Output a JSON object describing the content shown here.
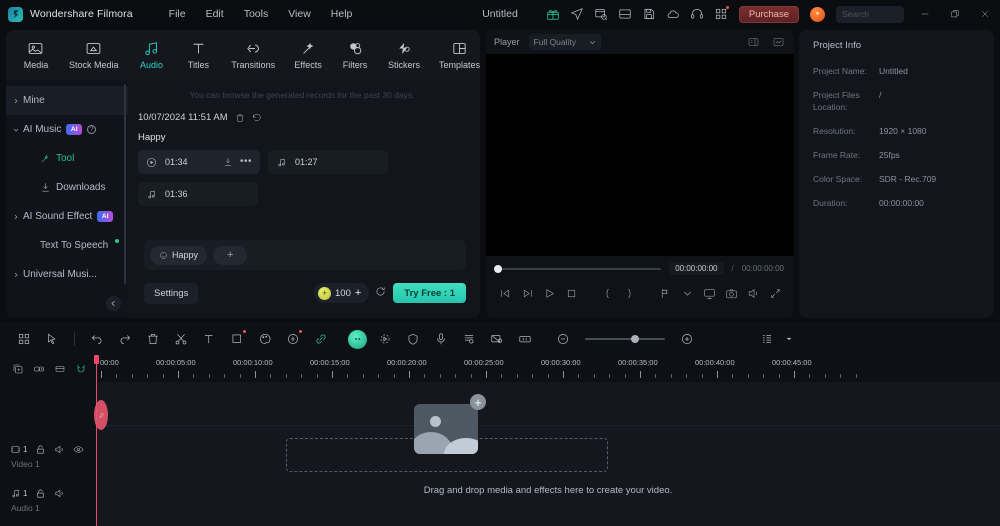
{
  "titlebar": {
    "brand": "Wondershare Filmora",
    "menus": [
      "File",
      "Edit",
      "Tools",
      "View",
      "Help"
    ],
    "document_title": "Untitled",
    "icons": [
      "gift-icon",
      "send-icon",
      "export-record-icon",
      "save-as-icon",
      "disk-icon",
      "cloud-icon",
      "headset-icon",
      "apps-grid-icon"
    ],
    "purchase_label": "Purchase",
    "search_placeholder": "Search",
    "window_controls": [
      "minimize",
      "restore",
      "close"
    ]
  },
  "tabs": [
    {
      "label": "Media",
      "icon": "media-icon",
      "active": false
    },
    {
      "label": "Stock Media",
      "icon": "stock-media-icon",
      "active": false
    },
    {
      "label": "Audio",
      "icon": "audio-note-icon",
      "active": true
    },
    {
      "label": "Titles",
      "icon": "titles-icon",
      "active": false
    },
    {
      "label": "Transitions",
      "icon": "transitions-icon",
      "active": false
    },
    {
      "label": "Effects",
      "icon": "effects-icon",
      "active": false
    },
    {
      "label": "Filters",
      "icon": "filters-icon",
      "active": false
    },
    {
      "label": "Stickers",
      "icon": "stickers-icon",
      "active": false
    },
    {
      "label": "Templates",
      "icon": "templates-icon",
      "active": false
    }
  ],
  "sidebar": {
    "items": [
      {
        "label": "Mine",
        "level": 0,
        "caret": "right",
        "selected": true
      },
      {
        "label": "AI Music",
        "level": 0,
        "caret": "down",
        "badge": "AI",
        "help": true
      },
      {
        "label": "Tool",
        "level": 1,
        "icon": "magic-wand-icon",
        "active": true
      },
      {
        "label": "Downloads",
        "level": 1,
        "icon": "download-icon",
        "active": false
      },
      {
        "label": "AI Sound Effect",
        "level": 0,
        "caret": "right",
        "badge": "AI"
      },
      {
        "label": "Text To Speech",
        "level": 1,
        "dot": true
      },
      {
        "label": "Universal Musi...",
        "level": 0,
        "caret": "right"
      }
    ],
    "collapse_icon": "chevron-left-icon"
  },
  "content": {
    "hint": "You can browse the generated records for the past 30 days.",
    "date": "10/07/2024 11:51 AM",
    "date_actions": [
      "trash-icon",
      "restore-icon"
    ],
    "group_title": "Happy",
    "cards": [
      {
        "time": "01:34",
        "icon": "play-circle-icon",
        "selected": true,
        "actions": [
          "download-icon",
          "more-icon"
        ]
      },
      {
        "time": "01:27",
        "icon": "music-note-icon",
        "selected": false
      },
      {
        "time": "01:36",
        "icon": "music-note-icon",
        "selected": false
      }
    ],
    "prompt_chip": "Happy",
    "add_chip": "+",
    "settings_label": "Settings",
    "credits": "100",
    "credits_plus": "+",
    "refresh_icon": "refresh-icon",
    "try_free_label": "Try Free : 1"
  },
  "player": {
    "label": "Player",
    "quality": "Full Quality",
    "header_icons": [
      "snapshot-grid-icon",
      "fit-screen-icon"
    ],
    "current_time": "00:00:00:00",
    "separator": "/",
    "total_time": "00:00:00:00",
    "controls": [
      "prev-frame-icon",
      "next-frame-icon",
      "play-icon",
      "stop-icon",
      "mark-in-icon",
      "mark-out-icon",
      "keyframe-icon",
      "chevron-down-icon",
      "render-preview-icon",
      "snapshot-icon",
      "volume-icon",
      "fullscreen-icon"
    ]
  },
  "project_info": {
    "title": "Project Info",
    "rows": [
      {
        "key": "Project Name:",
        "value": "Untitled"
      },
      {
        "key": "Project Files Location:",
        "value": "/"
      },
      {
        "key": "Resolution:",
        "value": "1920 × 1080"
      },
      {
        "key": "Frame Rate:",
        "value": "25fps"
      },
      {
        "key": "Color Space:",
        "value": "SDR - Rec.709"
      },
      {
        "key": "Duration:",
        "value": "00:00:00:00"
      }
    ]
  },
  "timeline_toolbar": {
    "left_icons": [
      "apps-grid-icon",
      "cursor-select-icon"
    ],
    "edit_icons": [
      "undo-icon",
      "redo-icon",
      "delete-icon",
      "split-scissors-icon",
      "text-icon",
      "crop-icon",
      "color-palette-icon",
      "ai-tools-icon",
      "link-icon"
    ],
    "right_icons": [
      "ai-copilot-icon",
      "motion-tracking-icon",
      "mask-icon",
      "record-voiceover-icon",
      "auto-caption-icon",
      "green-screen-icon",
      "speed-ramp-icon"
    ],
    "zoom_out_icon": "zoom-out-icon",
    "zoom_in_icon": "zoom-in-icon",
    "layout_icon": "track-layout-icon",
    "layout_caret": "chevron-down-icon"
  },
  "timeline": {
    "head_tools": [
      "add-track-icon",
      "link-track-icon",
      "marker-icon",
      "magnet-snap-icon"
    ],
    "ruler_ticks": [
      "00:00",
      "00:00:05:00",
      "00:00:10:00",
      "00:00:15:00",
      "00:00:20:00",
      "00:00:25:00",
      "00:00:30:00",
      "00:00:35:00",
      "00:00:40:00",
      "00:00:45:00"
    ],
    "tracks": [
      {
        "name": "Video 1",
        "count": "1",
        "icon": "video-icon",
        "controls": [
          "lock-icon",
          "mute-icon",
          "eye-icon"
        ]
      },
      {
        "name": "Audio 1",
        "count": "1",
        "icon": "audio-icon",
        "controls": [
          "lock-icon",
          "mute-icon"
        ]
      }
    ],
    "dropzone_text": "Drag and drop media and effects here to create your video.",
    "add_media_badge": "+"
  },
  "colors": {
    "accent_teal": "#2ad2c4",
    "accent_green": "#2fc08a",
    "playhead_red": "#f0476b",
    "purchase_red": "#7a2d2d",
    "try_free": "#3fe0c0"
  }
}
